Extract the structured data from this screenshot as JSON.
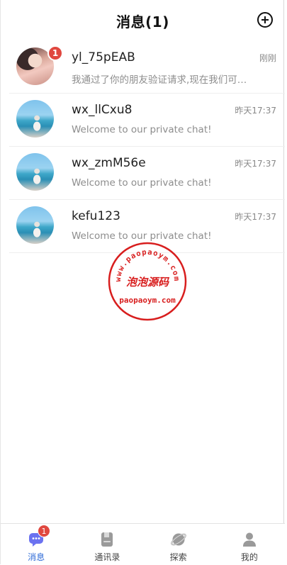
{
  "header": {
    "title": "消息(1)"
  },
  "chats": [
    {
      "name": "yl_75pEAB",
      "time": "刚刚",
      "preview": "我通过了你的朋友验证请求,现在我们可以...",
      "badge": "1",
      "avatar": "girl"
    },
    {
      "name": "wx_llCxu8",
      "time": "昨天17:37",
      "preview": "Welcome to our private chat!",
      "avatar": "beach"
    },
    {
      "name": "wx_zmM56e",
      "time": "昨天17:37",
      "preview": "Welcome to our private chat!",
      "avatar": "beach"
    },
    {
      "name": "kefu123",
      "time": "昨天17:37",
      "preview": "Welcome to our private chat!",
      "avatar": "beach"
    }
  ],
  "watermark": {
    "url_text": "www.paopaoym.com",
    "brand": "泡泡源码",
    "domain": "paopaoym.com",
    "color": "#d81e1e"
  },
  "tabbar": {
    "items": [
      {
        "label": "消息",
        "icon": "chat-bubble-icon",
        "badge": "1",
        "active": true
      },
      {
        "label": "通讯录",
        "icon": "contacts-book-icon"
      },
      {
        "label": "探索",
        "icon": "planet-icon"
      },
      {
        "label": "我的",
        "icon": "profile-icon"
      }
    ]
  },
  "colors": {
    "accent": "#2f6bd7",
    "badge": "#e0473f"
  }
}
